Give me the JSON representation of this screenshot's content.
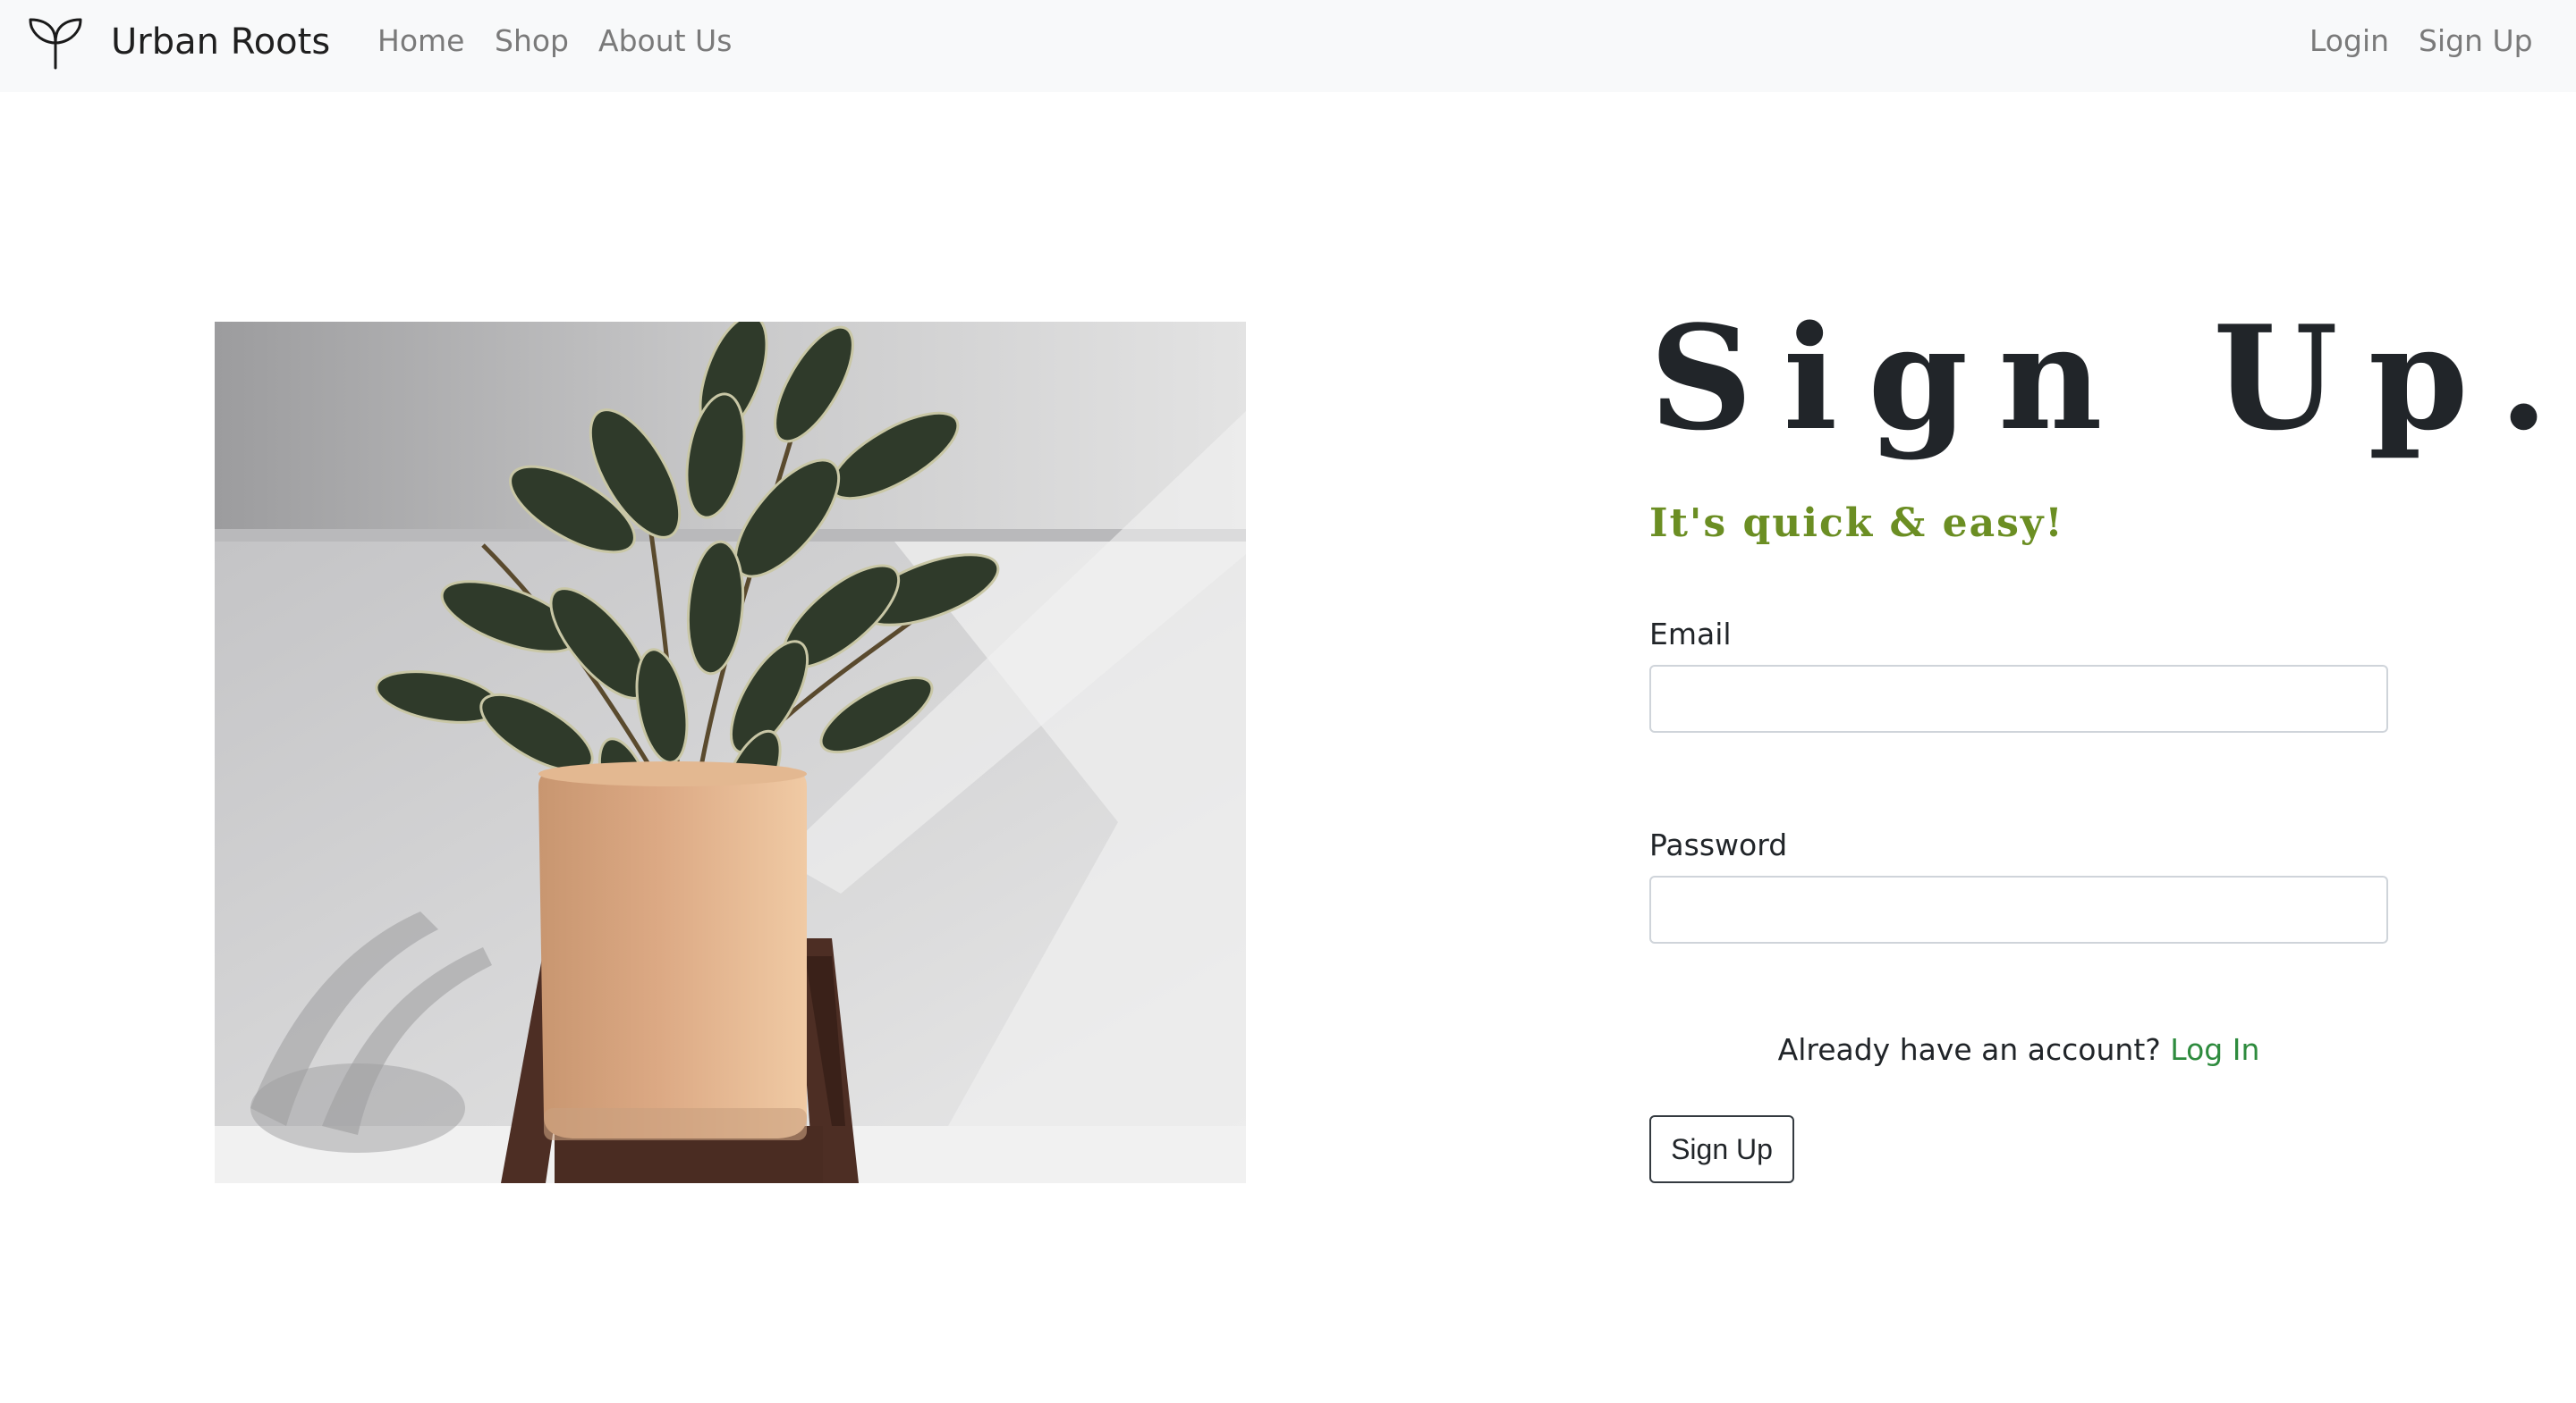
{
  "navbar": {
    "brand_icon": "sprout-icon",
    "brand": "Urban Roots",
    "links": [
      "Home",
      "Shop",
      "About Us"
    ],
    "right_links": [
      "Login",
      "Sign Up"
    ]
  },
  "hero": {
    "image": "potted-plant-photo"
  },
  "form": {
    "title": "Sign Up.",
    "subtitle": "It's quick & easy!",
    "email_label": "Email",
    "email_value": "",
    "password_label": "Password",
    "password_value": "",
    "account_prompt": "Already have an account?",
    "login_link": "Log In",
    "submit_label": "Sign Up"
  },
  "colors": {
    "accent_green": "#6b8e23",
    "link_green": "#2e8b3e",
    "text_dark": "#212529",
    "nav_bg": "#f8f9fa"
  }
}
